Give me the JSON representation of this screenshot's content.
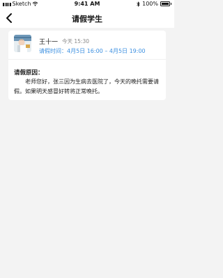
{
  "status_bar": {
    "carrier": "Sketch",
    "time": "9:41 AM",
    "battery": "100%",
    "battery_level": 1.0
  },
  "nav": {
    "title": "请假学生",
    "back_icon": "chevron-left-icon"
  },
  "card": {
    "student_name": "王十一",
    "time_ago": "今天 15:30",
    "leave_time": "请假时间：4月5日 16:00 – 4月5日 19:00",
    "reason_label": "请假原因：",
    "reason_text": "老师您好，张三因为生病去医院了，今天的晚托需要请假。如果明天感冒好转将正常晚托。"
  },
  "colors": {
    "accent": "#3b8fe0",
    "background": "#f3f3f3",
    "card": "#ffffff"
  }
}
